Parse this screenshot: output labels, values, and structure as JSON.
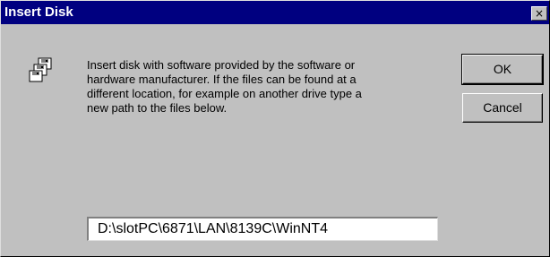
{
  "window": {
    "title": "Insert Disk",
    "close_glyph": "×"
  },
  "icon": {
    "name": "disk-stack-icon"
  },
  "message": "Insert disk with software provided by the software or\nhardware manufacturer.  If the files can be found at a\ndifferent location, for example on another drive type a\nnew path to the files below.",
  "buttons": {
    "ok_label": "OK",
    "cancel_label": "Cancel"
  },
  "path_field": {
    "value": "D:\\slotPC\\6871\\LAN\\8139C\\WinNT4"
  },
  "colors": {
    "titlebar": "#000080",
    "face": "#c0c0c0"
  }
}
